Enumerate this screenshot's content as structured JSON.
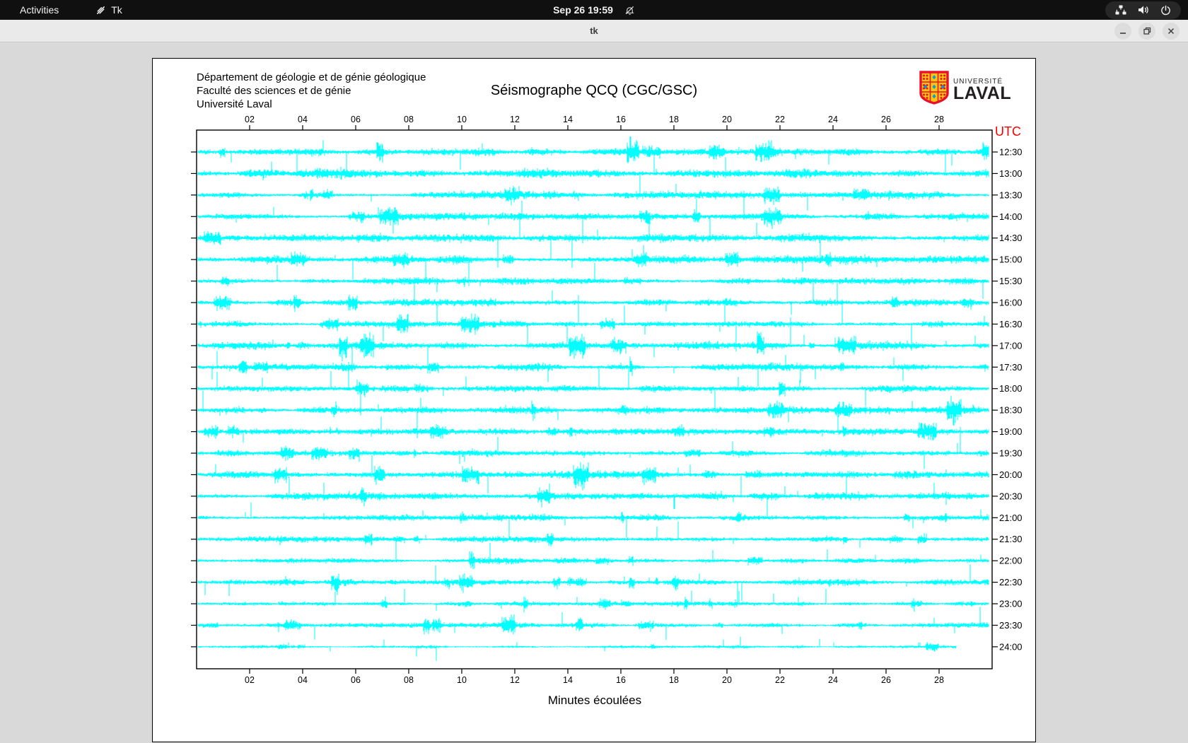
{
  "colors": {
    "trace": "#00ffff",
    "utc": "#f40000",
    "frame": "#000000",
    "laval_red": "#e8112d",
    "laval_gold": "#ffc60b",
    "laval_blue": "#009fdf"
  },
  "top_bar": {
    "activities_label": "Activities",
    "app_name": "Tk",
    "clock": "Sep 26  19:59",
    "icons": [
      "tk-icon",
      "bell-muted-icon",
      "network-icon",
      "volume-icon",
      "power-icon"
    ]
  },
  "window": {
    "title": "tk",
    "minimize_label": "minimize",
    "maximize_label": "maximize",
    "close_label": "close"
  },
  "seismograph": {
    "institution_lines": [
      "Département de géologie et de génie géologique",
      "Faculté des sciences et de génie",
      "Université Laval"
    ],
    "title": "Séismographe QCQ (CGC/GSC)",
    "utc_label": "UTC",
    "xlabel": "Minutes écoulées",
    "logo": {
      "line1": "UNIVERSITÉ",
      "line2": "LAVAL"
    }
  },
  "chart_data": {
    "type": "seismogram",
    "title": "Séismographe QCQ (CGC/GSC)",
    "xlabel": "Minutes écoulées",
    "x_minutes_range": [
      0,
      30
    ],
    "x_ticks": [
      2,
      4,
      6,
      8,
      10,
      12,
      14,
      16,
      18,
      20,
      22,
      24,
      26,
      28
    ],
    "x_tick_labels": [
      "02",
      "04",
      "06",
      "08",
      "10",
      "12",
      "14",
      "16",
      "18",
      "20",
      "22",
      "24",
      "26",
      "28"
    ],
    "row_labels_utc": [
      "12:30",
      "13:00",
      "13:30",
      "14:00",
      "14:30",
      "15:00",
      "15:30",
      "16:00",
      "16:30",
      "17:00",
      "17:30",
      "18:00",
      "18:30",
      "19:00",
      "19:30",
      "20:00",
      "20:30",
      "21:00",
      "21:30",
      "22:00",
      "22:30",
      "23:00",
      "23:30",
      "24:00"
    ],
    "trace_color": "#00ffff",
    "seed": 7,
    "row_activity": [
      1.1,
      1.35,
      1.0,
      1.05,
      1.25,
      1.2,
      0.95,
      1.0,
      1.05,
      1.1,
      1.0,
      0.95,
      1.0,
      0.9,
      0.95,
      1.05,
      1.0,
      0.9,
      0.85,
      0.8,
      0.9,
      0.7,
      0.75,
      0.45
    ],
    "last_row_end_fraction": 0.955
  }
}
